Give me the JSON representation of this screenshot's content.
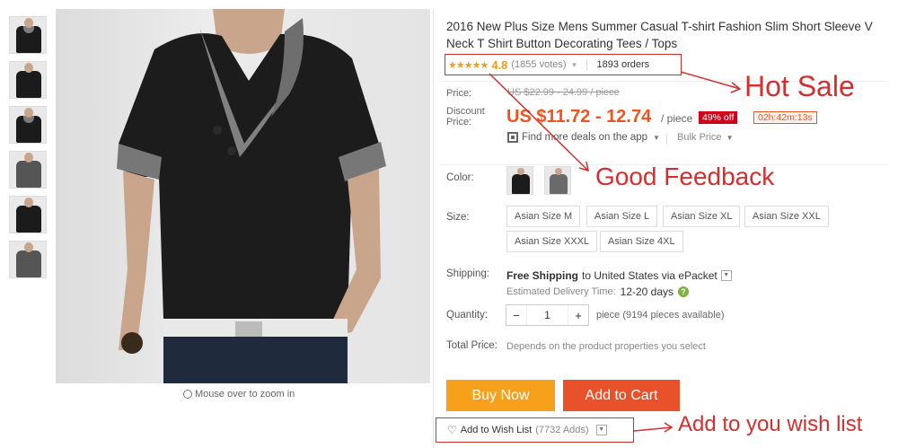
{
  "product": {
    "title": "2016 New Plus Size Mens Summer Casual T-shirt Fashion Slim Short Sleeve V Neck T Shirt Button Decorating Tees / Tops",
    "zoom_hint": "Mouse over to zoom in"
  },
  "rating": {
    "stars": "★★★★★",
    "value": "4.8",
    "votes": "(1855 votes)",
    "orders": "1893 orders"
  },
  "price": {
    "price_label": "Price:",
    "original": "US $22.99 - 24.99 / piece",
    "discount_label": "Discount Price:",
    "discount": "US $11.72 - 12.74",
    "per_piece": "/ piece",
    "badge": "49% off",
    "timer": "02h:42m:13s",
    "app_deal": "Find more deals on the app",
    "bulk": "Bulk Price"
  },
  "options": {
    "color_label": "Color:",
    "size_label": "Size:",
    "sizes": [
      "Asian Size M",
      "Asian Size L",
      "Asian Size XL",
      "Asian Size XXL",
      "Asian Size XXXL",
      "Asian Size 4XL"
    ]
  },
  "shipping": {
    "label": "Shipping:",
    "free": "Free Shipping",
    "dest": "to United States via ePacket",
    "eta_label": "Estimated Delivery Time:",
    "eta_days": "12-20 days"
  },
  "quantity": {
    "label": "Quantity:",
    "value": "1",
    "note": "piece (9194 pieces available)"
  },
  "total": {
    "label": "Total Price:",
    "note": "Depends on the product properties you select"
  },
  "actions": {
    "buy_now": "Buy Now",
    "add_to_cart": "Add to Cart",
    "wishlist": "Add to Wish List",
    "wishlist_count": "(7732 Adds)"
  },
  "annotations": {
    "hot_sale": "Hot Sale",
    "good_feedback": "Good Feedback",
    "wish_list": "Add to you wish list"
  },
  "colors": {
    "accent": "#f0541e",
    "annotation": "#d32f2f",
    "buy_now": "#f7a01c",
    "add_to_cart": "#e8512a"
  }
}
